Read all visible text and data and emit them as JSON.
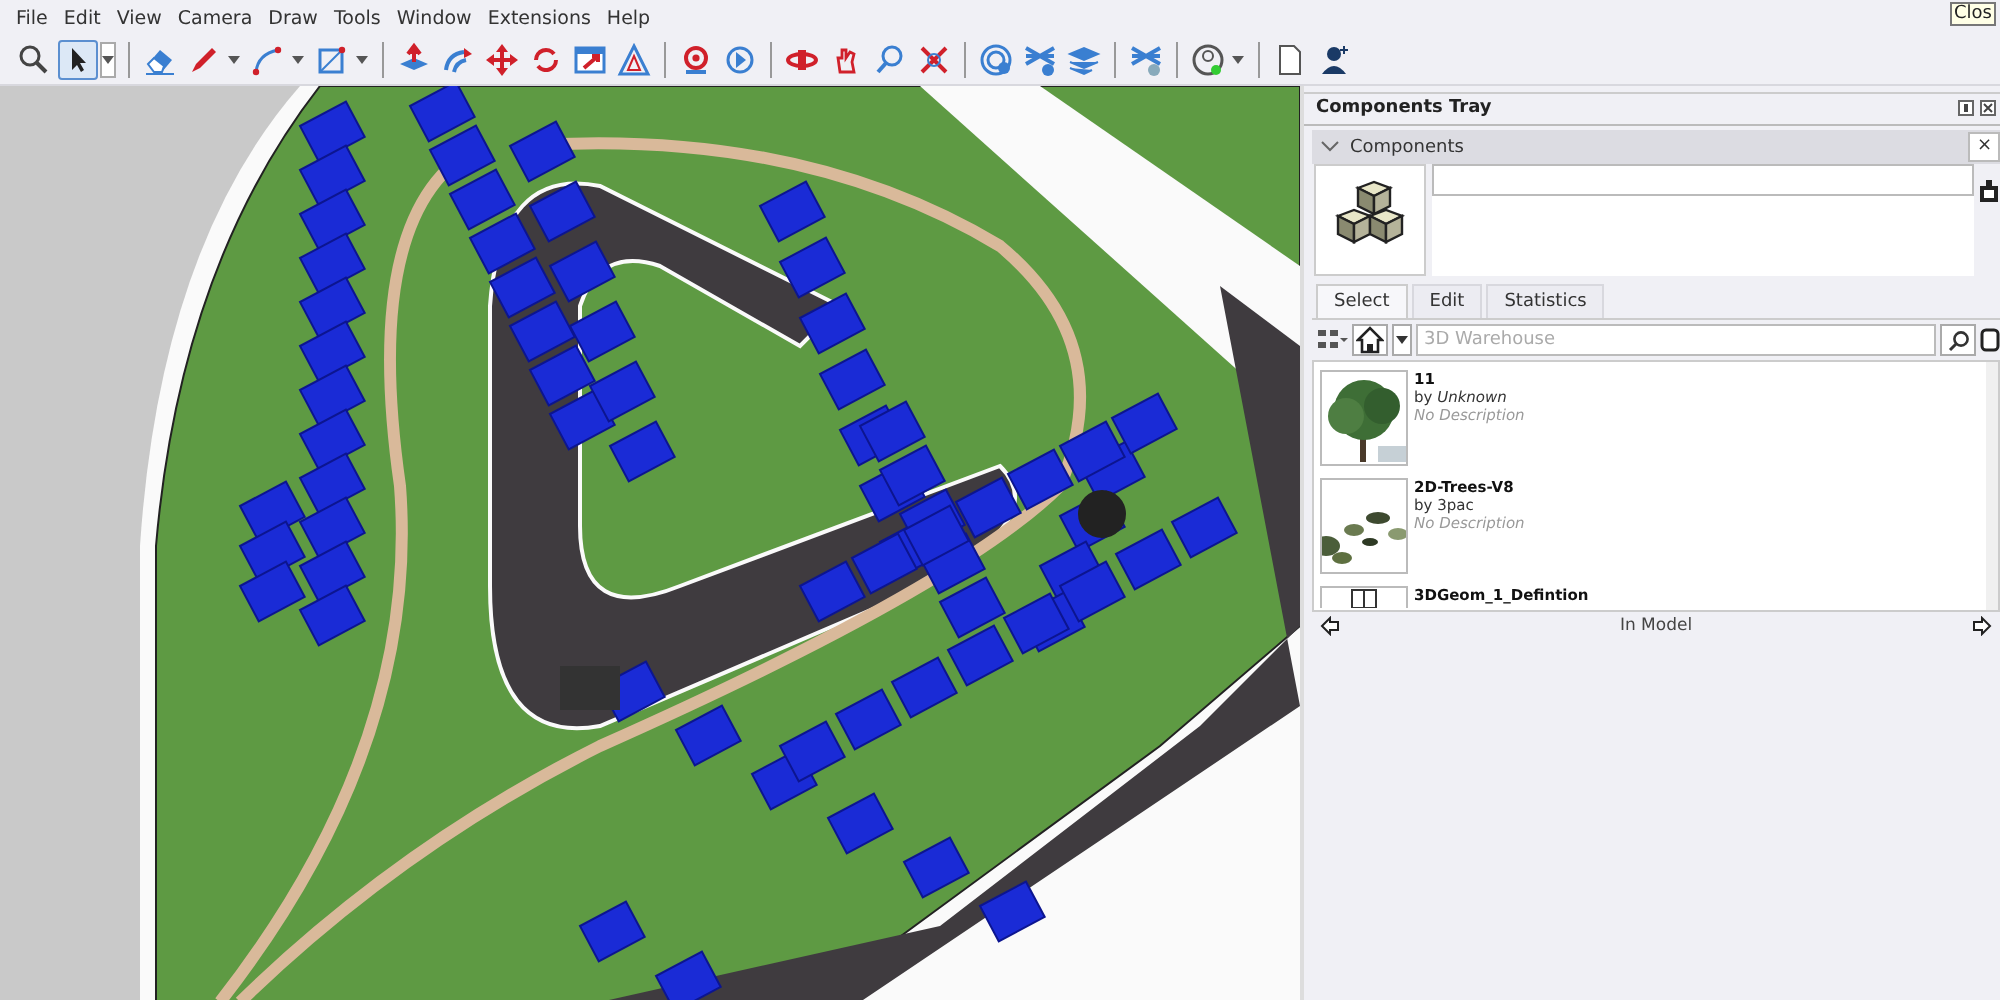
{
  "menu": [
    "File",
    "Edit",
    "View",
    "Camera",
    "Draw",
    "Tools",
    "Window",
    "Extensions",
    "Help"
  ],
  "toolbar": [
    {
      "kind": "zoom",
      "selected": false
    },
    {
      "kind": "select",
      "selected": true,
      "dropdown": true
    },
    {
      "kind": "separator"
    },
    {
      "kind": "eraser",
      "selected": false
    },
    {
      "kind": "pencil",
      "selected": false,
      "dropdown": true
    },
    {
      "kind": "arc",
      "selected": false,
      "dropdown": true
    },
    {
      "kind": "rectangle",
      "selected": false,
      "dropdown": true
    },
    {
      "kind": "separator"
    },
    {
      "kind": "pushpull",
      "selected": false
    },
    {
      "kind": "followme",
      "selected": false
    },
    {
      "kind": "move",
      "selected": false
    },
    {
      "kind": "rotate",
      "selected": false
    },
    {
      "kind": "scale",
      "selected": false
    },
    {
      "kind": "offset",
      "selected": false
    },
    {
      "kind": "separator"
    },
    {
      "kind": "position",
      "selected": false
    },
    {
      "kind": "walk",
      "selected": false
    },
    {
      "kind": "separator"
    },
    {
      "kind": "orbit",
      "selected": false
    },
    {
      "kind": "pan",
      "selected": false
    },
    {
      "kind": "zoomwin",
      "selected": false
    },
    {
      "kind": "extents",
      "selected": false
    },
    {
      "kind": "separator"
    },
    {
      "kind": "warehouse",
      "selected": false
    },
    {
      "kind": "extwarehouse",
      "selected": false
    },
    {
      "kind": "share",
      "selected": false
    },
    {
      "kind": "separator"
    },
    {
      "kind": "extmanager",
      "selected": false
    },
    {
      "kind": "separator"
    },
    {
      "kind": "account",
      "selected": false,
      "dropdown": true
    },
    {
      "kind": "separator"
    },
    {
      "kind": "document",
      "selected": false
    },
    {
      "kind": "user",
      "selected": false
    }
  ],
  "tooltip": "Clos",
  "tray": {
    "title": "Components Tray",
    "section": {
      "title": "Components",
      "expanded": true,
      "close": "×"
    },
    "tabs": [
      {
        "label": "Select",
        "selected": true
      },
      {
        "label": "Edit",
        "selected": false
      },
      {
        "label": "Statistics",
        "selected": false
      }
    ],
    "search": {
      "placeholder": "3D Warehouse"
    },
    "items": [
      {
        "kind": "tree",
        "name": "11",
        "author": "by *Unknown*",
        "description": "No Description"
      },
      {
        "kind": "scatter",
        "name": "2D-Trees-V8",
        "author": "by 3pac",
        "description": "No Description"
      },
      {
        "kind": "house",
        "name": "3DGeom_1_Defintion"
      }
    ],
    "footer": "In Model"
  }
}
